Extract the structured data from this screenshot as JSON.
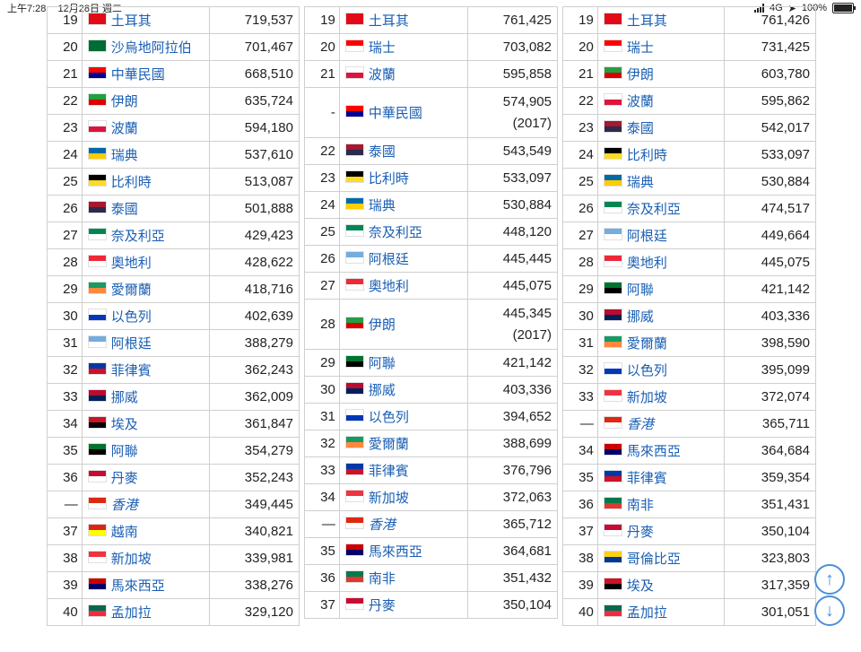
{
  "status": {
    "time": "上午7:28",
    "date": "12月28日 週二",
    "network": "4G",
    "battery": "100%"
  },
  "flag_colors": {
    "tr": [
      "#e30a17",
      "#e30a17"
    ],
    "sa": [
      "#006c35",
      "#006c35"
    ],
    "tw": [
      "#fe0000",
      "#000095"
    ],
    "ir": [
      "#239f40",
      "#da0000"
    ],
    "pl": [
      "#ffffff",
      "#dc143c"
    ],
    "se": [
      "#006aa7",
      "#fecc00"
    ],
    "be": [
      "#000000",
      "#fdda24"
    ],
    "th": [
      "#a51931",
      "#2d2a4a"
    ],
    "ng": [
      "#008751",
      "#ffffff"
    ],
    "at": [
      "#ed2939",
      "#ffffff"
    ],
    "ie": [
      "#169b62",
      "#ff883e"
    ],
    "il": [
      "#ffffff",
      "#0038b8"
    ],
    "ar": [
      "#74acdf",
      "#ffffff"
    ],
    "ph": [
      "#0038a8",
      "#ce1126"
    ],
    "no": [
      "#ba0c2f",
      "#00205b"
    ],
    "eg": [
      "#ce1126",
      "#000000"
    ],
    "ae": [
      "#00732f",
      "#000000"
    ],
    "dk": [
      "#c60c30",
      "#ffffff"
    ],
    "hk": [
      "#de2910",
      "#ffffff"
    ],
    "vn": [
      "#da251d",
      "#ffff00"
    ],
    "sg": [
      "#ef3340",
      "#ffffff"
    ],
    "my": [
      "#cc0001",
      "#010066"
    ],
    "bd": [
      "#006a4e",
      "#f42a41"
    ],
    "ch": [
      "#ff0000",
      "#ffffff"
    ],
    "za": [
      "#007a4d",
      "#de3831"
    ],
    "co": [
      "#fcd116",
      "#003893"
    ]
  },
  "columns": [
    {
      "rows": [
        {
          "rank": "19",
          "flag": "tr",
          "name": "土耳其",
          "value": "719,537"
        },
        {
          "rank": "20",
          "flag": "sa",
          "name": "沙烏地阿拉伯",
          "value": "701,467"
        },
        {
          "rank": "21",
          "flag": "tw",
          "name": "中華民國",
          "value": "668,510"
        },
        {
          "rank": "22",
          "flag": "ir",
          "name": "伊朗",
          "value": "635,724"
        },
        {
          "rank": "23",
          "flag": "pl",
          "name": "波蘭",
          "value": "594,180"
        },
        {
          "rank": "24",
          "flag": "se",
          "name": "瑞典",
          "value": "537,610"
        },
        {
          "rank": "25",
          "flag": "be",
          "name": "比利時",
          "value": "513,087"
        },
        {
          "rank": "26",
          "flag": "th",
          "name": "泰國",
          "value": "501,888"
        },
        {
          "rank": "27",
          "flag": "ng",
          "name": "奈及利亞",
          "value": "429,423"
        },
        {
          "rank": "28",
          "flag": "at",
          "name": "奧地利",
          "value": "428,622"
        },
        {
          "rank": "29",
          "flag": "ie",
          "name": "愛爾蘭",
          "value": "418,716"
        },
        {
          "rank": "30",
          "flag": "il",
          "name": "以色列",
          "value": "402,639"
        },
        {
          "rank": "31",
          "flag": "ar",
          "name": "阿根廷",
          "value": "388,279"
        },
        {
          "rank": "32",
          "flag": "ph",
          "name": "菲律賓",
          "value": "362,243"
        },
        {
          "rank": "33",
          "flag": "no",
          "name": "挪威",
          "value": "362,009"
        },
        {
          "rank": "34",
          "flag": "eg",
          "name": "埃及",
          "value": "361,847"
        },
        {
          "rank": "35",
          "flag": "ae",
          "name": "阿聯",
          "value": "354,279"
        },
        {
          "rank": "36",
          "flag": "dk",
          "name": "丹麥",
          "value": "352,243"
        },
        {
          "rank": "—",
          "flag": "hk",
          "name": "香港",
          "value": "349,445",
          "italic": true
        },
        {
          "rank": "37",
          "flag": "vn",
          "name": "越南",
          "value": "340,821"
        },
        {
          "rank": "38",
          "flag": "sg",
          "name": "新加坡",
          "value": "339,981"
        },
        {
          "rank": "39",
          "flag": "my",
          "name": "馬來西亞",
          "value": "338,276"
        },
        {
          "rank": "40",
          "flag": "bd",
          "name": "孟加拉",
          "value": "329,120"
        }
      ]
    },
    {
      "rows": [
        {
          "rank": "19",
          "flag": "tr",
          "name": "土耳其",
          "value": "761,425"
        },
        {
          "rank": "20",
          "flag": "ch",
          "name": "瑞士",
          "value": "703,082"
        },
        {
          "rank": "21",
          "flag": "pl",
          "name": "波蘭",
          "value": "595,858"
        },
        {
          "rank": "-",
          "flag": "tw",
          "name": "中華民國",
          "value": "574,905",
          "note": "(2017)"
        },
        {
          "rank": "22",
          "flag": "th",
          "name": "泰國",
          "value": "543,549"
        },
        {
          "rank": "23",
          "flag": "be",
          "name": "比利時",
          "value": "533,097"
        },
        {
          "rank": "24",
          "flag": "se",
          "name": "瑞典",
          "value": "530,884"
        },
        {
          "rank": "25",
          "flag": "ng",
          "name": "奈及利亞",
          "value": "448,120"
        },
        {
          "rank": "26",
          "flag": "ar",
          "name": "阿根廷",
          "value": "445,445"
        },
        {
          "rank": "27",
          "flag": "at",
          "name": "奧地利",
          "value": "445,075"
        },
        {
          "rank": "28",
          "flag": "ir",
          "name": "伊朗",
          "value": "445,345",
          "note": "(2017)"
        },
        {
          "rank": "29",
          "flag": "ae",
          "name": "阿聯",
          "value": "421,142"
        },
        {
          "rank": "30",
          "flag": "no",
          "name": "挪威",
          "value": "403,336"
        },
        {
          "rank": "31",
          "flag": "il",
          "name": "以色列",
          "value": "394,652"
        },
        {
          "rank": "32",
          "flag": "ie",
          "name": "愛爾蘭",
          "value": "388,699"
        },
        {
          "rank": "33",
          "flag": "ph",
          "name": "菲律賓",
          "value": "376,796"
        },
        {
          "rank": "34",
          "flag": "sg",
          "name": "新加坡",
          "value": "372,063"
        },
        {
          "rank": "—",
          "flag": "hk",
          "name": "香港",
          "value": "365,712",
          "italic": true
        },
        {
          "rank": "35",
          "flag": "my",
          "name": "馬來西亞",
          "value": "364,681"
        },
        {
          "rank": "36",
          "flag": "za",
          "name": "南非",
          "value": "351,432"
        },
        {
          "rank": "37",
          "flag": "dk",
          "name": "丹麥",
          "value": "350,104"
        }
      ]
    },
    {
      "rows": [
        {
          "rank": "19",
          "flag": "tr",
          "name": "土耳其",
          "value": "761,426"
        },
        {
          "rank": "20",
          "flag": "ch",
          "name": "瑞士",
          "value": "731,425"
        },
        {
          "rank": "21",
          "flag": "ir",
          "name": "伊朗",
          "value": "603,780"
        },
        {
          "rank": "22",
          "flag": "pl",
          "name": "波蘭",
          "value": "595,862"
        },
        {
          "rank": "23",
          "flag": "th",
          "name": "泰國",
          "value": "542,017"
        },
        {
          "rank": "24",
          "flag": "be",
          "name": "比利時",
          "value": "533,097"
        },
        {
          "rank": "25",
          "flag": "se",
          "name": "瑞典",
          "value": "530,884"
        },
        {
          "rank": "26",
          "flag": "ng",
          "name": "奈及利亞",
          "value": "474,517"
        },
        {
          "rank": "27",
          "flag": "ar",
          "name": "阿根廷",
          "value": "449,664"
        },
        {
          "rank": "28",
          "flag": "at",
          "name": "奧地利",
          "value": "445,075"
        },
        {
          "rank": "29",
          "flag": "ae",
          "name": "阿聯",
          "value": "421,142"
        },
        {
          "rank": "30",
          "flag": "no",
          "name": "挪威",
          "value": "403,336"
        },
        {
          "rank": "31",
          "flag": "ie",
          "name": "愛爾蘭",
          "value": "398,590"
        },
        {
          "rank": "32",
          "flag": "il",
          "name": "以色列",
          "value": "395,099"
        },
        {
          "rank": "33",
          "flag": "sg",
          "name": "新加坡",
          "value": "372,074"
        },
        {
          "rank": "—",
          "flag": "hk",
          "name": "香港",
          "value": "365,711",
          "italic": true
        },
        {
          "rank": "34",
          "flag": "my",
          "name": "馬來西亞",
          "value": "364,684"
        },
        {
          "rank": "35",
          "flag": "ph",
          "name": "菲律賓",
          "value": "359,354"
        },
        {
          "rank": "36",
          "flag": "za",
          "name": "南非",
          "value": "351,431"
        },
        {
          "rank": "37",
          "flag": "dk",
          "name": "丹麥",
          "value": "350,104"
        },
        {
          "rank": "38",
          "flag": "co",
          "name": "哥倫比亞",
          "value": "323,803"
        },
        {
          "rank": "39",
          "flag": "eg",
          "name": "埃及",
          "value": "317,359"
        },
        {
          "rank": "40",
          "flag": "bd",
          "name": "孟加拉",
          "value": "301,051"
        }
      ]
    }
  ],
  "scroll_buttons": {
    "up_icon": "arrow-up-icon",
    "down_icon": "arrow-down-icon"
  }
}
